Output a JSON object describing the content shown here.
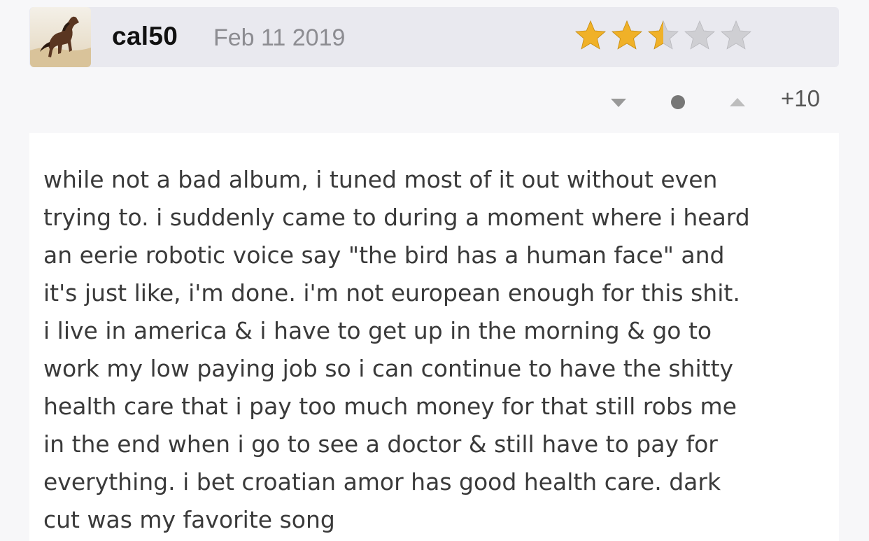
{
  "review": {
    "username": "cal50",
    "date": "Feb 11 2019",
    "rating": {
      "value": 2.5,
      "max": 5,
      "icon": "star-icon",
      "filled_color": "#f0b128",
      "empty_color": "#cfcfd3"
    },
    "votes": {
      "score": "+10",
      "down_icon": "triangle-down-icon",
      "neutral_icon": "dot-icon",
      "up_icon": "triangle-up-icon"
    },
    "avatar_icon": "horse-avatar-icon",
    "text": "while not a bad album, i tuned most of it out without even\ntrying to. i suddenly came to during a moment where i heard\nan eerie robotic voice say \"the bird has a human face\" and\nit's just like, i'm done. i'm not european enough for this shit.\ni live in america & i have to get up in the morning & go to\nwork my low paying job so i can continue to have the shitty\nhealth care that i pay too much money for that still robs me\nin the end when i go to see a doctor & still have to pay for\neverything. i bet croatian amor has good health care. dark\ncut was my favorite song"
  }
}
